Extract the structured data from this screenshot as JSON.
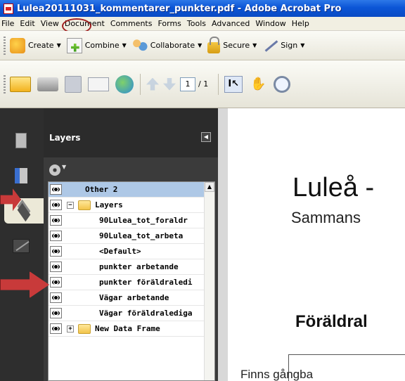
{
  "window": {
    "title": "Lulea20111031_kommentarer_punkter.pdf - Adobe Acrobat Pro"
  },
  "menu": [
    "File",
    "Edit",
    "View",
    "Document",
    "Comments",
    "Forms",
    "Tools",
    "Advanced",
    "Window",
    "Help"
  ],
  "toolbar": {
    "create": "Create",
    "combine": "Combine",
    "collaborate": "Collaborate",
    "secure": "Secure",
    "sign": "Sign"
  },
  "navigation": {
    "current_page": "1",
    "total_pages": "/ 1"
  },
  "layers_panel": {
    "title": "Layers",
    "items": [
      {
        "label": "Other 2",
        "selected": true
      },
      {
        "label": "Layers",
        "expander": "−",
        "folder": true
      },
      {
        "label": "90Lulea_tot_foraldr"
      },
      {
        "label": "90Lulea_tot_arbeta"
      },
      {
        "label": "<Default>"
      },
      {
        "label": "punkter arbetande"
      },
      {
        "label": "punkter föräldraledi"
      },
      {
        "label": "Vägar arbetande"
      },
      {
        "label": "Vägar föräldralediga"
      },
      {
        "label": "New Data Frame",
        "expander": "+",
        "folder": true
      }
    ]
  },
  "document": {
    "title": "Luleå -",
    "subtitle": "Sammans",
    "heading": "Föräldral",
    "box_text": "Finns gångba"
  },
  "colors": {
    "titlebar": "#0b55d6",
    "annotation_red": "#c83a3a",
    "selected_row": "#aec8e6"
  }
}
